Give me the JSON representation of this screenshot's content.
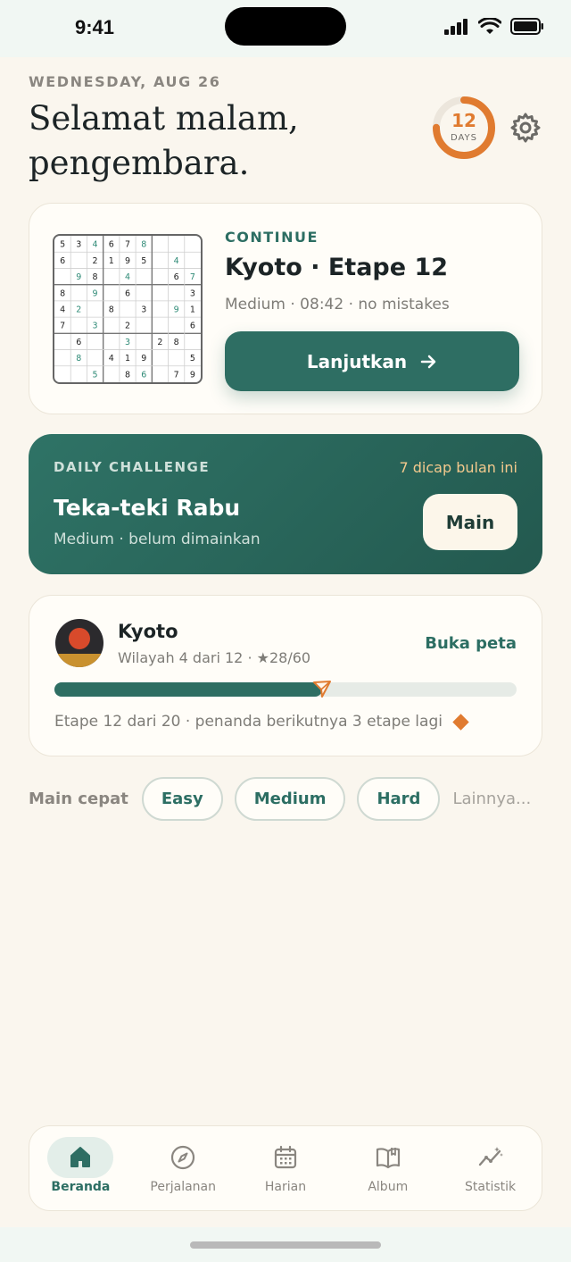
{
  "status_bar": {
    "time": "9:41"
  },
  "header": {
    "date": "WEDNESDAY, AUG 26",
    "greeting": "Selamat malam, pengembara.",
    "streak": {
      "count": "12",
      "label": "DAYS",
      "progress": 0.75
    }
  },
  "continue_card": {
    "label": "CONTINUE",
    "title": "Kyoto · Etape 12",
    "meta": "Medium · 08:42 · no mistakes",
    "button_label": "Lanjutkan",
    "grid": [
      [
        "5",
        "3",
        "4",
        "6",
        "7",
        "8",
        "",
        "",
        ""
      ],
      [
        "6",
        "",
        "2",
        "1",
        "9",
        "5",
        "",
        "4",
        ""
      ],
      [
        "",
        "9",
        "8",
        "",
        "4",
        "",
        "",
        "6",
        "7"
      ],
      [
        "8",
        "",
        "9",
        "",
        "6",
        "",
        "",
        "",
        "3"
      ],
      [
        "4",
        "2",
        "",
        "8",
        "",
        "3",
        "",
        "9",
        "1"
      ],
      [
        "7",
        "",
        "3",
        "",
        "2",
        "",
        "",
        "",
        "6"
      ],
      [
        "",
        "6",
        "",
        "",
        "3",
        "",
        "2",
        "8",
        ""
      ],
      [
        "",
        "8",
        "",
        "4",
        "1",
        "9",
        "",
        "",
        "5"
      ],
      [
        "",
        "",
        "5",
        "",
        "8",
        "6",
        "",
        "7",
        "9"
      ]
    ],
    "given": [
      [
        1,
        1,
        0,
        1,
        1,
        0,
        0,
        0,
        0
      ],
      [
        1,
        0,
        1,
        1,
        1,
        1,
        0,
        0,
        0
      ],
      [
        0,
        0,
        1,
        0,
        0,
        0,
        0,
        1,
        0
      ],
      [
        1,
        0,
        0,
        0,
        1,
        0,
        0,
        0,
        1
      ],
      [
        1,
        0,
        0,
        1,
        0,
        1,
        0,
        0,
        1
      ],
      [
        1,
        0,
        0,
        0,
        1,
        0,
        0,
        0,
        1
      ],
      [
        0,
        1,
        0,
        0,
        0,
        0,
        1,
        1,
        0
      ],
      [
        0,
        0,
        0,
        1,
        1,
        1,
        0,
        0,
        1
      ],
      [
        0,
        0,
        0,
        0,
        1,
        0,
        0,
        1,
        1
      ]
    ]
  },
  "daily": {
    "label": "DAILY CHALLENGE",
    "stamps": "7 dicap bulan ini",
    "title": "Teka-teki Rabu",
    "subtitle": "Medium · belum dimainkan",
    "button_label": "Main"
  },
  "region": {
    "name": "Kyoto",
    "meta": "Wilayah 4 dari 12 · ★28/60",
    "open_map": "Buka peta",
    "progress": 0.58,
    "footer": "Etape 12 dari 20 · penanda berikutnya 3 etape lagi"
  },
  "quick_play": {
    "label": "Main cepat",
    "options": [
      "Easy",
      "Medium",
      "Hard"
    ],
    "more": "Lainnya..."
  },
  "tabs": [
    {
      "label": "Beranda",
      "icon": "home-icon",
      "active": true
    },
    {
      "label": "Perjalanan",
      "icon": "compass-icon",
      "active": false
    },
    {
      "label": "Harian",
      "icon": "calendar-icon",
      "active": false
    },
    {
      "label": "Album",
      "icon": "book-icon",
      "active": false
    },
    {
      "label": "Statistik",
      "icon": "stats-icon",
      "active": false
    }
  ],
  "colors": {
    "accent": "#2e6e63",
    "orange": "#e07b30",
    "background": "#faf6ee"
  }
}
